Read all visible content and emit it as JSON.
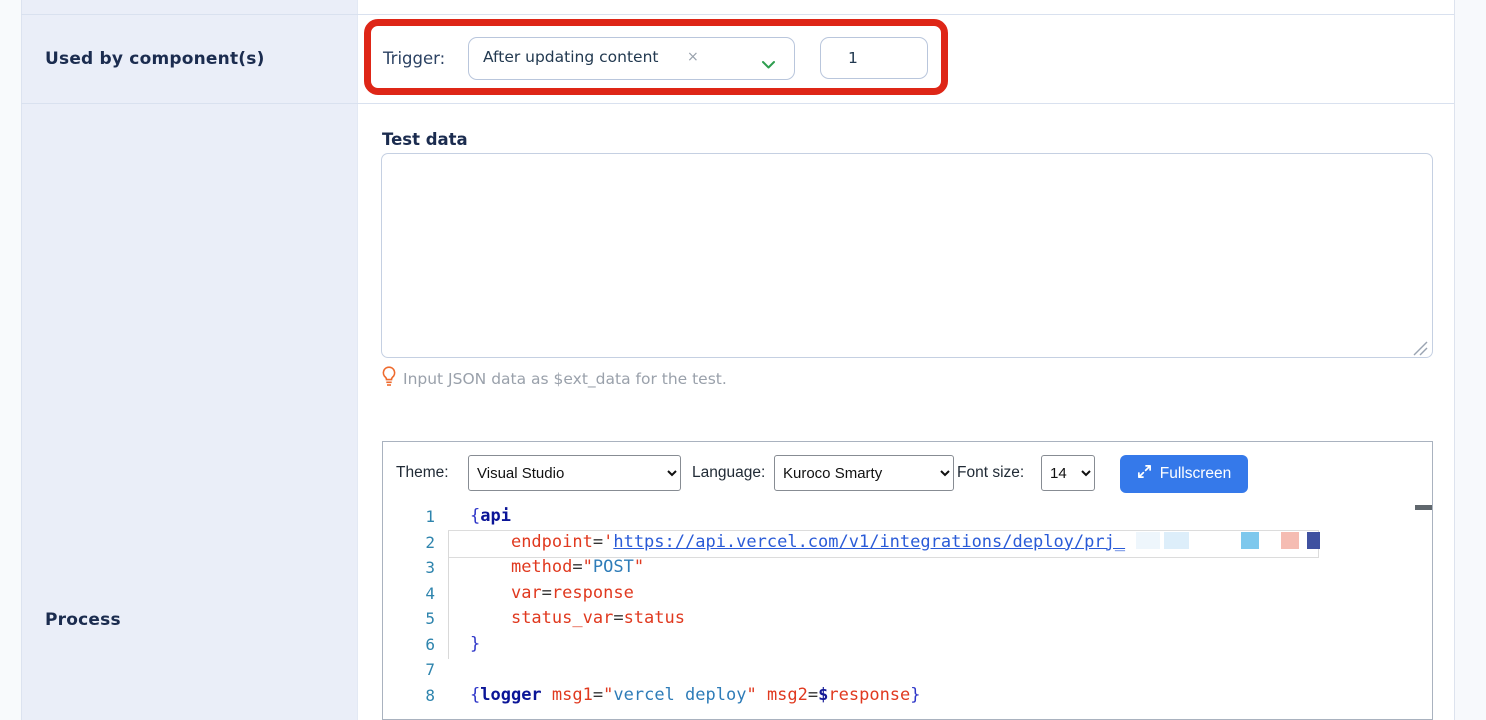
{
  "form": {
    "rows": [
      {
        "label": "Used by component(s)"
      },
      {
        "label": "Process"
      }
    ]
  },
  "trigger": {
    "label": "Trigger:",
    "selected_option": "After updating content",
    "remove_icon": "×",
    "value": "1",
    "annotation_color": "#de2617"
  },
  "test_data": {
    "heading": "Test data",
    "textarea_value": "",
    "hint": "Input JSON data as $ext_data for the test."
  },
  "editor": {
    "toolbar": {
      "theme_label": "Theme:",
      "theme_value": "Visual Studio",
      "language_label": "Language:",
      "language_value": "Kuroco Smarty",
      "font_size_label": "Font size:",
      "font_size_value": "14",
      "fullscreen_label": "Fullscreen"
    },
    "colors": {
      "keyword": "#0b1597",
      "attribute": "#e0391f",
      "string": "#2e7cb8",
      "link": "#2a5bd7",
      "delimiter": "#2d35c8",
      "line_number": "#2e84ad"
    },
    "code": {
      "lines": [
        {
          "tokens": [
            [
              "delim",
              "{"
            ],
            [
              "kw",
              "api"
            ]
          ]
        },
        {
          "tokens": [
            [
              "plain",
              "    "
            ],
            [
              "red",
              "endpoint"
            ],
            [
              "op",
              "="
            ],
            [
              "red",
              "'"
            ],
            [
              "link",
              "https://api.vercel.com/v1/integrations/deploy/prj_"
            ]
          ]
        },
        {
          "tokens": [
            [
              "plain",
              "    "
            ],
            [
              "red",
              "method"
            ],
            [
              "op",
              "="
            ],
            [
              "red",
              "\""
            ],
            [
              "str",
              "POST"
            ],
            [
              "red",
              "\""
            ]
          ]
        },
        {
          "tokens": [
            [
              "plain",
              "    "
            ],
            [
              "red",
              "var"
            ],
            [
              "op",
              "="
            ],
            [
              "red",
              "response"
            ]
          ]
        },
        {
          "tokens": [
            [
              "plain",
              "    "
            ],
            [
              "red",
              "status_var"
            ],
            [
              "op",
              "="
            ],
            [
              "red",
              "status"
            ]
          ]
        },
        {
          "tokens": [
            [
              "delim",
              "}"
            ]
          ]
        },
        {
          "tokens": []
        },
        {
          "tokens": [
            [
              "delim",
              "{"
            ],
            [
              "kw",
              "logger"
            ],
            [
              "plain",
              " "
            ],
            [
              "red",
              "msg1"
            ],
            [
              "op",
              "="
            ],
            [
              "red",
              "\""
            ],
            [
              "str",
              "vercel deploy"
            ],
            [
              "red",
              "\""
            ],
            [
              "plain",
              " "
            ],
            [
              "red",
              "msg2"
            ],
            [
              "op",
              "="
            ],
            [
              "dollar",
              "$"
            ],
            [
              "red",
              "response"
            ],
            [
              "delim",
              "}"
            ]
          ]
        }
      ]
    }
  }
}
